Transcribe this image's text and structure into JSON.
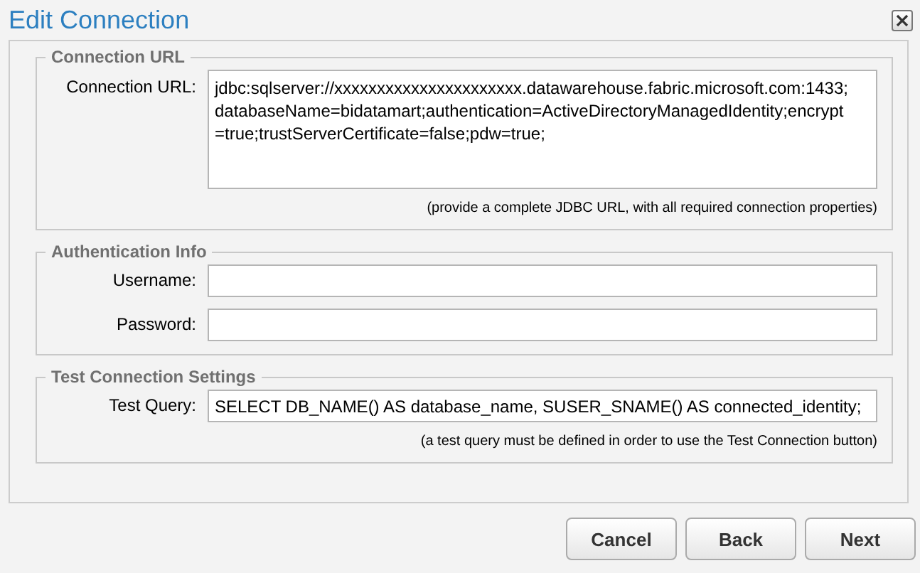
{
  "window": {
    "title": "Edit Connection"
  },
  "sections": [
    {
      "legend": "Connection URL",
      "fields": [
        {
          "kind": "multiline",
          "label": "Connection URL:",
          "value_lines": [
            "jdbc:sqlserver://xxxxxxxxxxxxxxxxxxxxxx.datawarehouse.fabric.microsoft.com:1433;",
            "databaseName=bidatamart;authentication=ActiveDirectoryManagedIdentity;encrypt",
            "=true;trustServerCertificate=false;pdw=true;"
          ]
        }
      ],
      "hint": "(provide a complete JDBC URL, with all required connection properties)"
    },
    {
      "legend": "Authentication Info",
      "fields": [
        {
          "kind": "text",
          "label": "Username:"
        },
        {
          "kind": "text",
          "label": "Password:"
        }
      ]
    },
    {
      "legend": "Test Connection Settings",
      "fields": [
        {
          "kind": "text",
          "label": "Test Query:",
          "value": "SELECT DB_NAME() AS database_name, SUSER_SNAME() AS connected_identity;"
        }
      ],
      "hint": "(a test query must be defined in order to use the Test Connection button)"
    }
  ],
  "buttons": [
    "Cancel",
    "Back",
    "Next"
  ]
}
